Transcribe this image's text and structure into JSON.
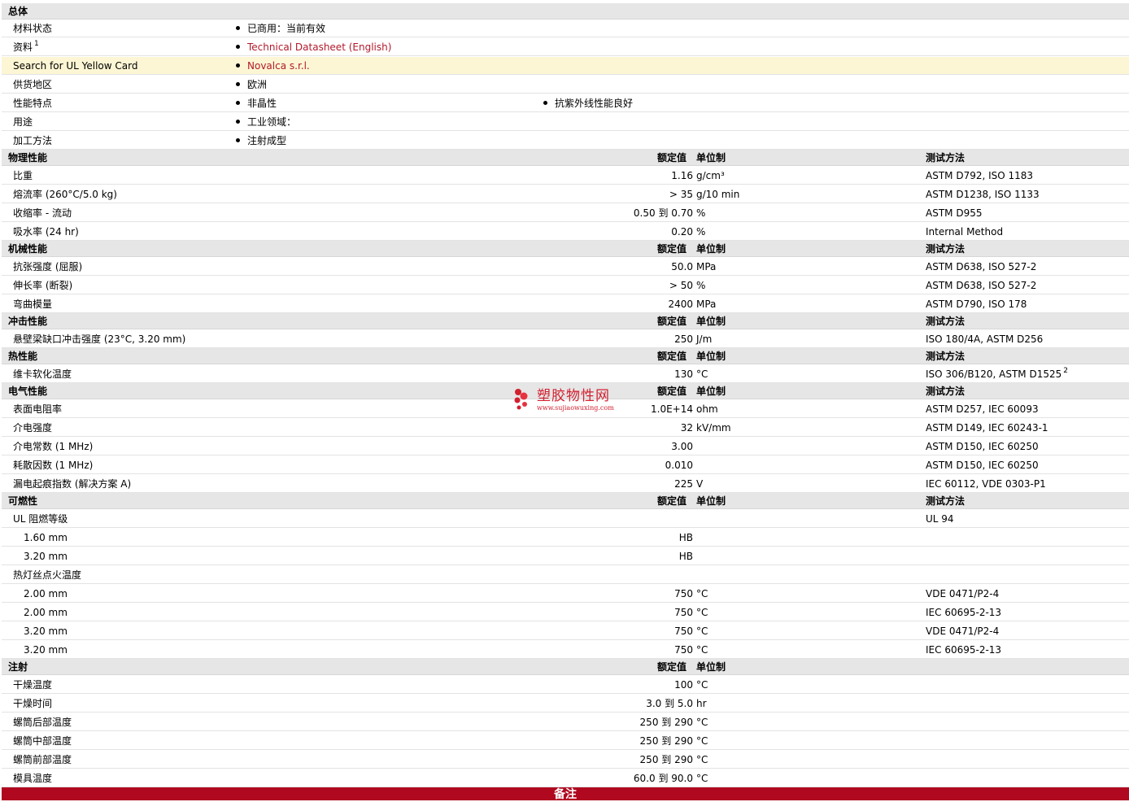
{
  "general": {
    "title": "总体",
    "material_status": {
      "label": "材料状态",
      "value": "已商用：当前有效"
    },
    "literature": {
      "label": "资料",
      "sup": "1",
      "link": "Technical Datasheet (English)"
    },
    "ul_yellow_card": {
      "label": "Search for UL Yellow Card",
      "link": "Novalca s.r.l."
    },
    "availability": {
      "label": "供货地区",
      "value": "欧洲"
    },
    "features": {
      "label": "性能特点",
      "value1": "非晶性",
      "value2": "抗紫外线性能良好"
    },
    "uses": {
      "label": "用途",
      "value": "工业领域："
    },
    "processing": {
      "label": "加工方法",
      "value": "注射成型"
    }
  },
  "headers": {
    "nominal": "额定值",
    "unit": "单位制",
    "test": "测试方法"
  },
  "physical": {
    "title": "物理性能",
    "rows": [
      {
        "label": "比重",
        "value": "1.16",
        "unit": "g/cm³",
        "test": "ASTM D792, ISO 1183"
      },
      {
        "label": "熔流率  (260°C/5.0 kg)",
        "value": "> 35",
        "unit": "g/10 min",
        "test": "ASTM D1238, ISO 1133"
      },
      {
        "label": "收缩率  - 流动",
        "value": "0.50 到  0.70",
        "unit": "%",
        "test": "ASTM D955"
      },
      {
        "label": "吸水率  (24 hr)",
        "value": "0.20",
        "unit": "%",
        "test": "Internal Method"
      }
    ]
  },
  "mechanical": {
    "title": "机械性能",
    "rows": [
      {
        "label": "抗张强度  (屈服)",
        "value": "50.0",
        "unit": "MPa",
        "test": "ASTM D638, ISO 527-2"
      },
      {
        "label": "伸长率  (断裂)",
        "value": "> 50",
        "unit": "%",
        "test": "ASTM D638, ISO 527-2"
      },
      {
        "label": "弯曲模量",
        "value": "2400",
        "unit": "MPa",
        "test": "ASTM D790, ISO 178"
      }
    ]
  },
  "impact": {
    "title": "冲击性能",
    "rows": [
      {
        "label": "悬壁梁缺口冲击强度  (23°C, 3.20 mm)",
        "value": "250",
        "unit": "J/m",
        "test": "ISO 180/4A, ASTM D256"
      }
    ]
  },
  "thermal": {
    "title": "热性能",
    "rows": [
      {
        "label": "维卡软化温度",
        "value": "130",
        "unit": "°C",
        "test": "ISO 306/B120, ASTM D1525",
        "test_sup": "2"
      }
    ]
  },
  "electrical": {
    "title": "电气性能",
    "rows": [
      {
        "label": "表面电阻率",
        "value": "1.0E+14",
        "unit": "ohm",
        "test": "ASTM D257, IEC 60093"
      },
      {
        "label": "介电强度",
        "value": "32",
        "unit": "kV/mm",
        "test": "ASTM D149, IEC 60243-1"
      },
      {
        "label": "介电常数  (1 MHz)",
        "value": "3.00",
        "unit": "",
        "test": "ASTM D150, IEC 60250"
      },
      {
        "label": "耗散因数  (1 MHz)",
        "value": "0.010",
        "unit": "",
        "test": "ASTM D150, IEC 60250"
      },
      {
        "label": "漏电起痕指数  (解决方案  A)",
        "value": "225",
        "unit": "V",
        "test": "IEC 60112, VDE 0303-P1"
      }
    ]
  },
  "flammability": {
    "title": "可燃性",
    "rows": [
      {
        "label": "UL 阻燃等级",
        "value": "",
        "unit": "",
        "test": "UL 94"
      },
      {
        "label": "1.60 mm",
        "value": "HB",
        "unit": "",
        "test": ""
      },
      {
        "label": "3.20 mm",
        "value": "HB",
        "unit": "",
        "test": ""
      },
      {
        "label": "热灯丝点火温度",
        "value": "",
        "unit": "",
        "test": ""
      },
      {
        "label": "2.00 mm",
        "value": "750",
        "unit": "°C",
        "test": "VDE 0471/P2-4"
      },
      {
        "label": "2.00 mm",
        "value": "750",
        "unit": "°C",
        "test": "IEC 60695-2-13"
      },
      {
        "label": "3.20 mm",
        "value": "750",
        "unit": "°C",
        "test": "VDE 0471/P2-4"
      },
      {
        "label": "3.20 mm",
        "value": "750",
        "unit": "°C",
        "test": "IEC 60695-2-13"
      }
    ]
  },
  "injection": {
    "title": "注射",
    "rows": [
      {
        "label": "干燥温度",
        "value": "100",
        "unit": "°C"
      },
      {
        "label": "干燥时间",
        "value": "3.0 到  5.0",
        "unit": "hr"
      },
      {
        "label": "螺筒后部温度",
        "value": "250 到  290",
        "unit": "°C"
      },
      {
        "label": "螺筒中部温度",
        "value": "250 到  290",
        "unit": "°C"
      },
      {
        "label": "螺筒前部温度",
        "value": "250 到  290",
        "unit": "°C"
      },
      {
        "label": "模具温度",
        "value": "60.0 到  90.0",
        "unit": "°C"
      }
    ]
  },
  "notes": {
    "title": "备注"
  },
  "watermark": {
    "title": "塑胶物性网",
    "url": "www.sujiaowuxing.com",
    "color": "#d2202f"
  },
  "colors": {
    "section_bg": "#e6e6e6",
    "highlight_bg": "#fcf6d4",
    "link": "#b3192b",
    "footer_bg": "#b0081f"
  }
}
